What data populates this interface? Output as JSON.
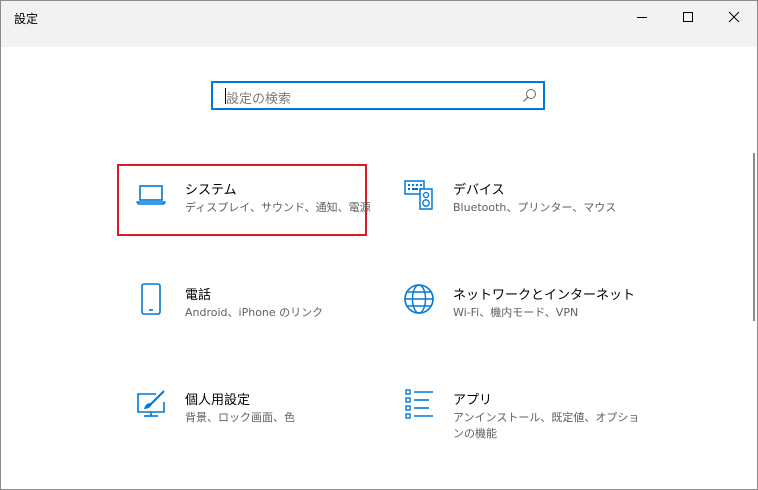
{
  "window": {
    "title": "設定"
  },
  "search": {
    "placeholder": "設定の検索"
  },
  "tiles": [
    {
      "label": "システム",
      "desc": "ディスプレイ、サウンド、通知、電源",
      "icon": "laptop-icon"
    },
    {
      "label": "デバイス",
      "desc": "Bluetooth、プリンター、マウス",
      "icon": "keyboard-speaker-icon"
    },
    {
      "label": "電話",
      "desc": "Android、iPhone のリンク",
      "icon": "phone-icon"
    },
    {
      "label": "ネットワークとインターネット",
      "desc": "Wi-Fi、機内モード、VPN",
      "icon": "globe-icon"
    },
    {
      "label": "個人用設定",
      "desc": "背景、ロック画面、色",
      "icon": "paint-brush-icon"
    },
    {
      "label": "アプリ",
      "desc": "アンインストール、既定値、オプションの機能",
      "icon": "app-list-icon"
    }
  ],
  "colors": {
    "accent": "#0078d7",
    "selection_border": "#d91b26",
    "titlebar": "#f2f2f2"
  }
}
